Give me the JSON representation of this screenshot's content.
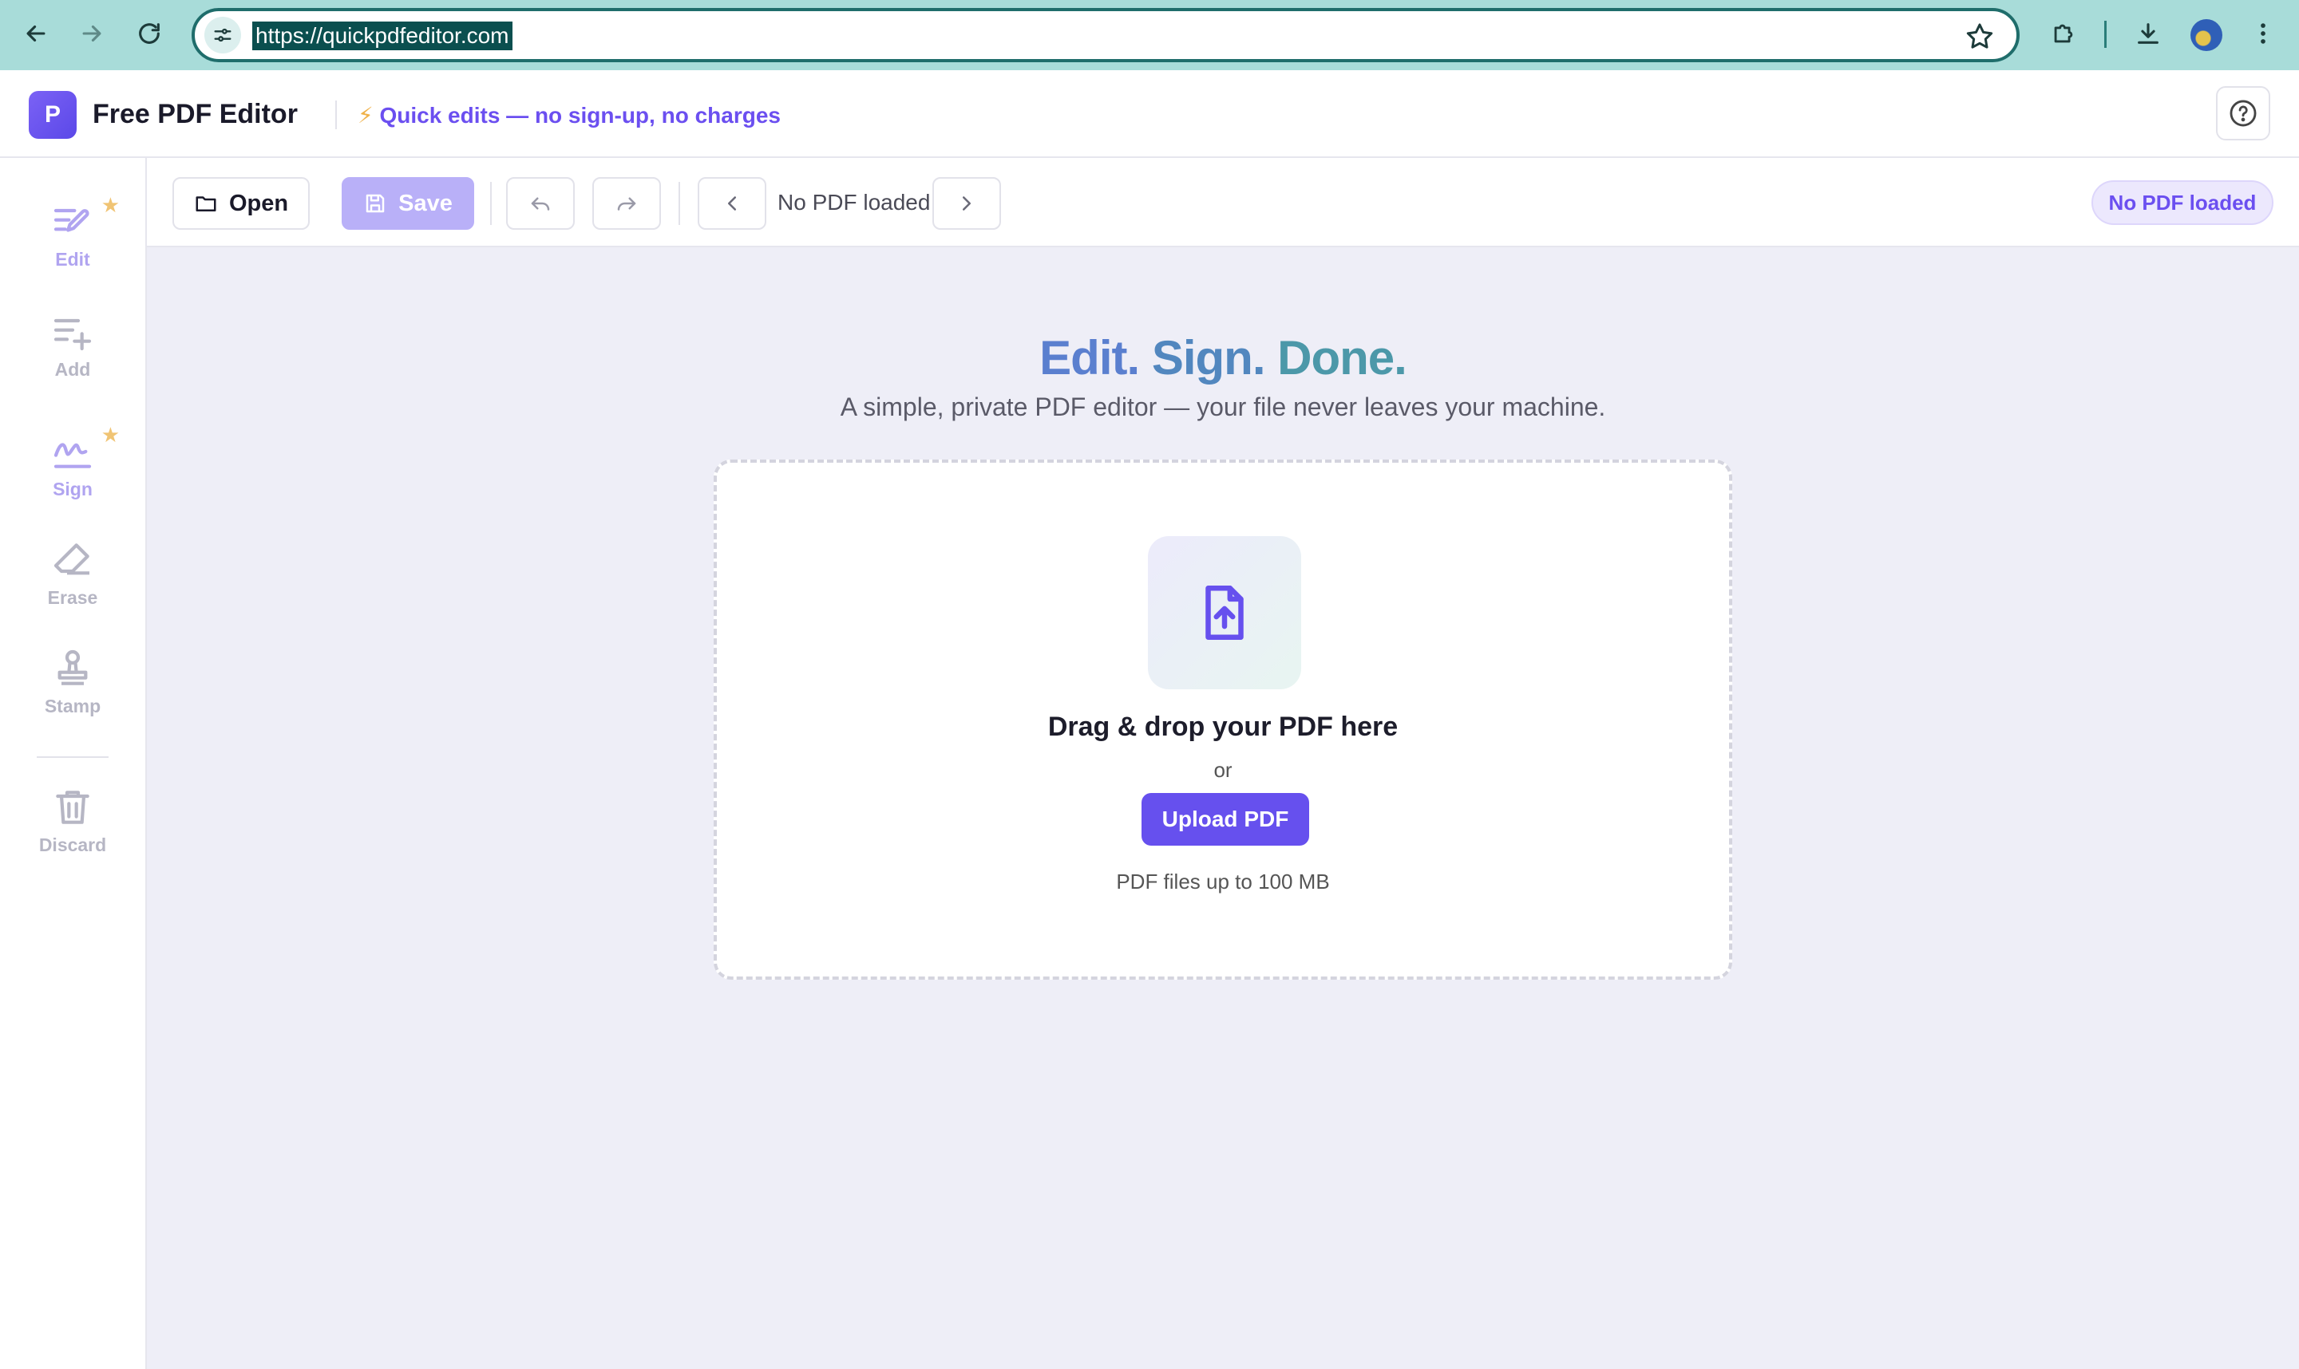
{
  "browser": {
    "url": "https://quickpdfeditor.com"
  },
  "header": {
    "logo_letter": "P",
    "app_name": "Free PDF Editor",
    "tagline_icon": "⚡",
    "tagline": "Quick edits — no sign-up, no charges"
  },
  "sidebar": {
    "tools": [
      {
        "label": "Edit",
        "icon": "edit-icon",
        "starred": true
      },
      {
        "label": "Add",
        "icon": "add-icon",
        "starred": false
      },
      {
        "label": "Sign",
        "icon": "sign-icon",
        "starred": true
      },
      {
        "label": "Erase",
        "icon": "eraser-icon",
        "starred": false
      },
      {
        "label": "Stamp",
        "icon": "stamp-icon",
        "starred": false
      },
      {
        "label": "Discard",
        "icon": "trash-icon",
        "starred": false
      }
    ]
  },
  "toolbar": {
    "open_label": "Open",
    "save_label": "Save",
    "page_indicator": "No PDF loaded",
    "status_pill": "No PDF loaded"
  },
  "hero": {
    "title_part1": "Edit.",
    "title_part2": "Sign.",
    "title_part3": "Done.",
    "subtitle": "A simple, private PDF editor — your file never leaves your machine."
  },
  "dropzone": {
    "title": "Drag & drop your PDF here",
    "or": "or",
    "upload_label": "Upload PDF",
    "note": "PDF files up to 100 MB"
  },
  "colors": {
    "accent": "#6650ee",
    "chrome": "#a8dcd9",
    "background": "#eeeef7"
  }
}
